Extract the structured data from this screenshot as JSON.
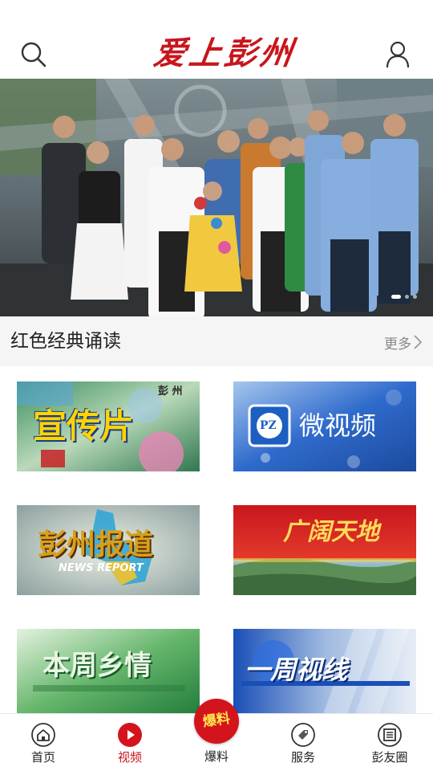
{
  "header": {
    "app_title": "爱上彭州",
    "search_icon": "search-icon",
    "user_icon": "user-icon",
    "brand_color": "#c8161d"
  },
  "banner": {
    "slide_count": 3,
    "active_slide": 1
  },
  "section": {
    "title": "红色经典诵读",
    "more_label": "更多"
  },
  "grid": {
    "tiles": [
      {
        "title": "宣传片",
        "badge": "彭 州"
      },
      {
        "title": "微视频",
        "badge": "PZ"
      },
      {
        "title": "彭州报道",
        "badge": "NEWS REPORT"
      },
      {
        "title": "广阔天地",
        "caption": ""
      },
      {
        "title": "本周乡情",
        "caption": ""
      },
      {
        "title": "一周视线",
        "caption": ""
      }
    ]
  },
  "bottom_nav": {
    "items": [
      {
        "label": "首页",
        "icon": "home-icon"
      },
      {
        "label": "视频",
        "icon": "play-icon",
        "active": true
      },
      {
        "label": "爆料",
        "icon": "baoliao-badge",
        "badge_text": "爆料"
      },
      {
        "label": "服务",
        "icon": "tag-icon"
      },
      {
        "label": "彭友圈",
        "icon": "news-icon"
      }
    ],
    "active_color": "#c8161d"
  }
}
